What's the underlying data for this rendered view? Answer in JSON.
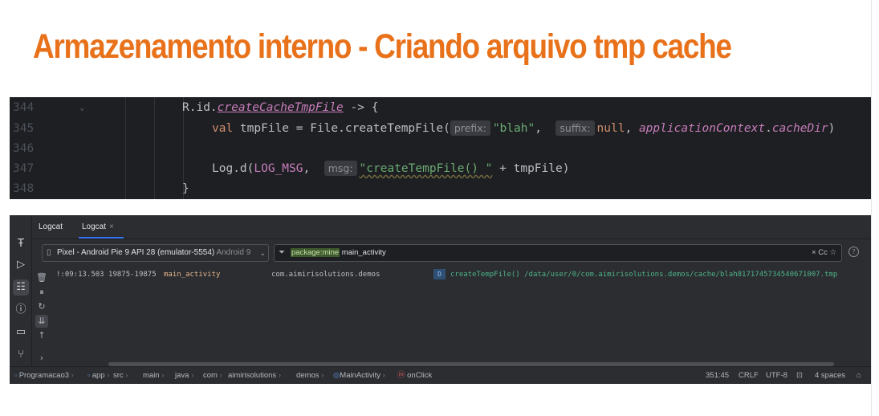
{
  "slide": {
    "title": "Armazenamento interno - Criando arquivo tmp cache"
  },
  "editor": {
    "lines": [
      {
        "number": "344",
        "tokens": [
          {
            "text": "R.id.",
            "cls": "t-plain"
          },
          {
            "text": "createCacheTmpFile",
            "cls": "t-fn"
          },
          {
            "text": " -> {",
            "cls": "t-plain"
          }
        ],
        "indent": 215
      },
      {
        "number": "345",
        "tokens": [
          {
            "text": "val ",
            "cls": "t-kw"
          },
          {
            "text": "tmpFile = File.createTempFile(",
            "cls": "t-plain"
          },
          {
            "hint": "prefix:"
          },
          {
            "text": "\"blah\"",
            "cls": "t-str"
          },
          {
            "text": ",  ",
            "cls": "t-plain"
          },
          {
            "hint": "suffix:"
          },
          {
            "text": "null",
            "cls": "t-kw"
          },
          {
            "text": ", ",
            "cls": "t-plain"
          },
          {
            "text": "applicationContext",
            "cls": "t-prop"
          },
          {
            "text": ".",
            "cls": "t-plain"
          },
          {
            "text": "cacheDir",
            "cls": "t-prop"
          },
          {
            "text": ")",
            "cls": "t-plain"
          }
        ],
        "indent": 252
      },
      {
        "number": "346",
        "tokens": [],
        "indent": 252
      },
      {
        "number": "347",
        "tokens": [
          {
            "text": "Log.d(",
            "cls": "t-plain"
          },
          {
            "text": "LOG_MSG",
            "cls": "t-const"
          },
          {
            "text": ",  ",
            "cls": "t-plain"
          },
          {
            "hint": "msg:"
          },
          {
            "text": "\"createTempFile() \"",
            "cls": "t-str wavy"
          },
          {
            "text": " + tmpFile)",
            "cls": "t-plain"
          }
        ],
        "indent": 252
      },
      {
        "number": "348",
        "tokens": [
          {
            "text": "}",
            "cls": "t-plain"
          }
        ],
        "indent": 215
      }
    ]
  },
  "logcat": {
    "tabs": {
      "first": "Logcat",
      "second": "Logcat",
      "close": "×"
    },
    "device": {
      "name": "Pixel - Android Pie 9 API 28 (emulator-5554)",
      "suffix": "Android 9"
    },
    "filter": {
      "key": "package:mine",
      "value": "main_activity",
      "controls": "×   Cc  ☆"
    },
    "help": "?",
    "entry": {
      "timestamp": "!:09:13.503 19875-19875",
      "tag": "main_activity",
      "package": "com.aimirisolutions.demos",
      "level": "D",
      "message": "createTempFile() /data/user/0/com.aimirisolutions.demos/cache/blah8171745734540671007.tmp"
    }
  },
  "statusbar": {
    "breadcrumbs": [
      "Programacao3",
      "app",
      "src",
      "main",
      "java",
      "com",
      "aimirisolutions",
      "demos",
      "MainActivity",
      "onClick"
    ],
    "position": "351:45",
    "line_separator": "CRLF",
    "encoding": "UTF-8",
    "indent": "4 spaces"
  },
  "colors": {
    "title": "#e8711a",
    "editor_bg": "#1e1f22",
    "ide_bg": "#2b2d30"
  }
}
